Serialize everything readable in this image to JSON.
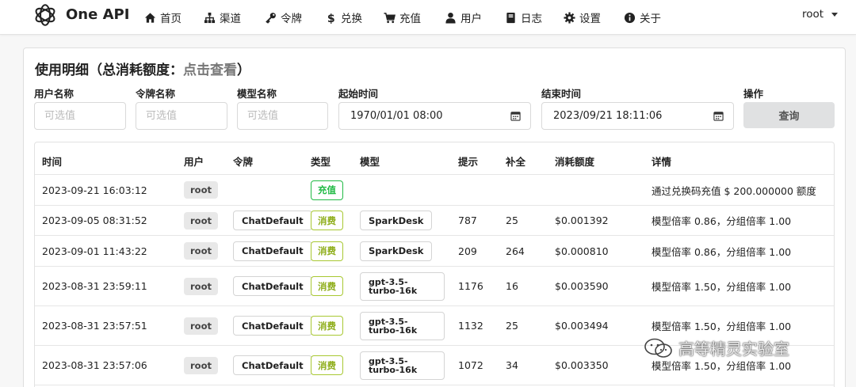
{
  "app": {
    "brand": "One API"
  },
  "nav": {
    "items": [
      {
        "label": "首页",
        "icon": "home-icon"
      },
      {
        "label": "渠道",
        "icon": "sitemap-icon"
      },
      {
        "label": "令牌",
        "icon": "key-icon"
      },
      {
        "label": "兑换",
        "icon": "dollar-icon"
      },
      {
        "label": "充值",
        "icon": "cart-icon"
      },
      {
        "label": "用户",
        "icon": "user-icon"
      },
      {
        "label": "日志",
        "icon": "book-icon"
      },
      {
        "label": "设置",
        "icon": "gear-icon"
      },
      {
        "label": "关于",
        "icon": "info-icon"
      }
    ],
    "user": "root"
  },
  "page": {
    "title_prefix": "使用明细（总消耗额度：",
    "title_link": "点击查看",
    "title_suffix": "）"
  },
  "filters": {
    "username": {
      "label": "用户名称",
      "placeholder": "可选值"
    },
    "token_name": {
      "label": "令牌名称",
      "placeholder": "可选值"
    },
    "model_name": {
      "label": "模型名称",
      "placeholder": "可选值"
    },
    "start_time": {
      "label": "起始时间",
      "value": "1970/01/01 08:00"
    },
    "end_time": {
      "label": "结束时间",
      "value": "2023/09/21 18:11:06"
    },
    "action": {
      "label": "操作",
      "button": "查询"
    }
  },
  "table": {
    "columns": [
      "时间",
      "用户",
      "令牌",
      "类型",
      "模型",
      "提示",
      "补全",
      "消耗额度",
      "详情"
    ],
    "rows": [
      {
        "time": "2023-09-21 16:03:12",
        "user": "root",
        "token": "",
        "type": "充值",
        "type_kind": "recharge",
        "model": "",
        "prompt": "",
        "completion": "",
        "quota": "",
        "detail": "通过兑换码充值 $ 200.000000 额度"
      },
      {
        "time": "2023-09-05 08:31:52",
        "user": "root",
        "token": "ChatDefault",
        "type": "消费",
        "type_kind": "consume",
        "model": "SparkDesk",
        "prompt": "787",
        "completion": "25",
        "quota": "$0.001392",
        "detail": "模型倍率 0.86，分组倍率 1.00"
      },
      {
        "time": "2023-09-01 11:43:22",
        "user": "root",
        "token": "ChatDefault",
        "type": "消费",
        "type_kind": "consume",
        "model": "SparkDesk",
        "prompt": "209",
        "completion": "264",
        "quota": "$0.000810",
        "detail": "模型倍率 0.86，分组倍率 1.00"
      },
      {
        "time": "2023-08-31 23:59:11",
        "user": "root",
        "token": "ChatDefault",
        "type": "消费",
        "type_kind": "consume",
        "model": "gpt-3.5-turbo-16k",
        "prompt": "1176",
        "completion": "16",
        "quota": "$0.003590",
        "detail": "模型倍率 1.50，分组倍率 1.00"
      },
      {
        "time": "2023-08-31 23:57:51",
        "user": "root",
        "token": "ChatDefault",
        "type": "消费",
        "type_kind": "consume",
        "model": "gpt-3.5-turbo-16k",
        "prompt": "1132",
        "completion": "25",
        "quota": "$0.003494",
        "detail": "模型倍率 1.50，分组倍率 1.00"
      },
      {
        "time": "2023-08-31 23:57:06",
        "user": "root",
        "token": "ChatDefault",
        "type": "消费",
        "type_kind": "consume",
        "model": "gpt-3.5-turbo-16k",
        "prompt": "1072",
        "completion": "34",
        "quota": "$0.003350",
        "detail": "模型倍率 1.50，分组倍率 1.00"
      }
    ]
  },
  "watermark": {
    "text": "高等精灵实验室"
  },
  "colors": {
    "recharge": "#21ba45",
    "consume": "#a8c832",
    "nav_bg": "#ffffff",
    "page_bg": "#f7f7f7"
  }
}
